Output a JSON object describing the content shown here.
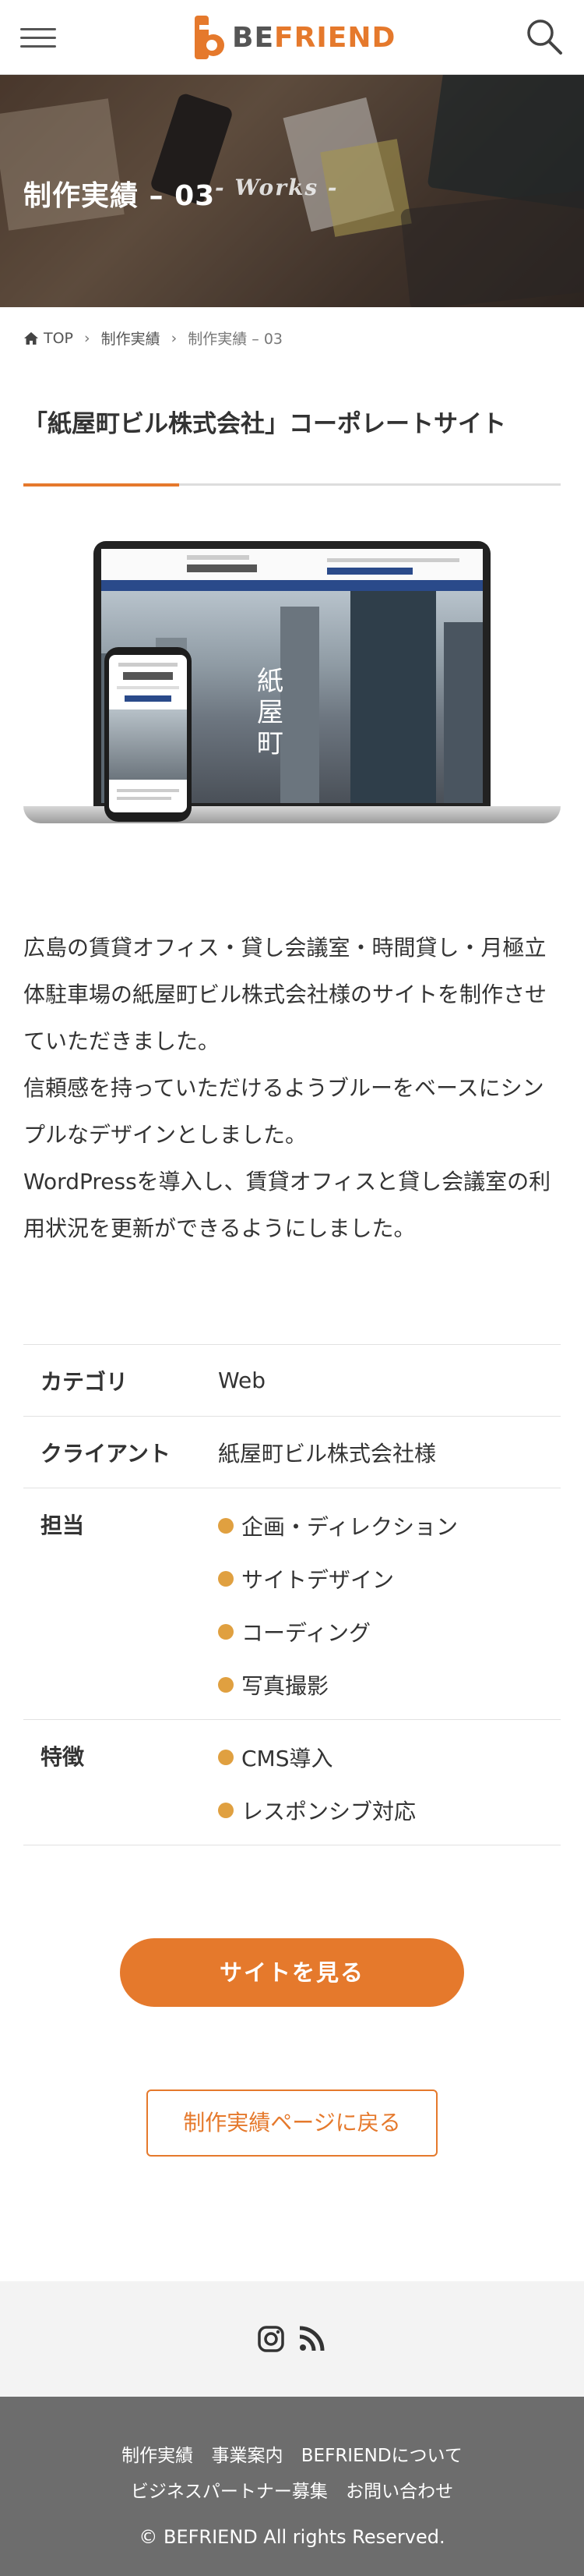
{
  "header": {
    "menu_icon": "hamburger-menu-icon",
    "logo_be": "BE",
    "logo_friend": "FRIEND",
    "search_icon": "search-icon",
    "accent_color": "#e5792c"
  },
  "hero": {
    "title": "制作実績 – 03",
    "subtitle": "- Works -"
  },
  "breadcrumb": {
    "home_icon": "home-icon",
    "items": [
      "TOP",
      "制作実績",
      "制作実績 – 03"
    ]
  },
  "project": {
    "title": "「紙屋町ビル株式会社」コーポレートサイト",
    "description": [
      "広島の賃貸オフィス・貸し会議室・時間貸し・月極立体駐車場の紙屋町ビル株式会社様のサイトを制作させていただきました。",
      "信頼感を持っていただけるようブルーをベースにシンプルなデザインとしました。",
      "WordPressを導入し、賃貸オフィスと貸し会議室の利用状況を更新ができるようにしました。"
    ]
  },
  "info": {
    "category_label": "カテゴリ",
    "category_value": "Web",
    "client_label": "クライアント",
    "client_value": "紙屋町ビル株式会社様",
    "roles_label": "担当",
    "roles": [
      "企画・ディレクション",
      "サイトデザイン",
      "コーディング",
      "写真撮影"
    ],
    "features_label": "特徴",
    "features": [
      "CMS導入",
      "レスポンシブ対応"
    ]
  },
  "buttons": {
    "view_site": "サイトを見る",
    "back": "制作実績ページに戻る"
  },
  "social": {
    "icons": [
      "instagram-icon",
      "rss-icon"
    ]
  },
  "footer": {
    "nav_row1": [
      "制作実績",
      "事業案内",
      "BEFRIENDについて"
    ],
    "nav_row2": [
      "ビジネスパートナー募集",
      "お問い合わせ"
    ],
    "copyright": "© BEFRIEND All rights Reserved."
  }
}
